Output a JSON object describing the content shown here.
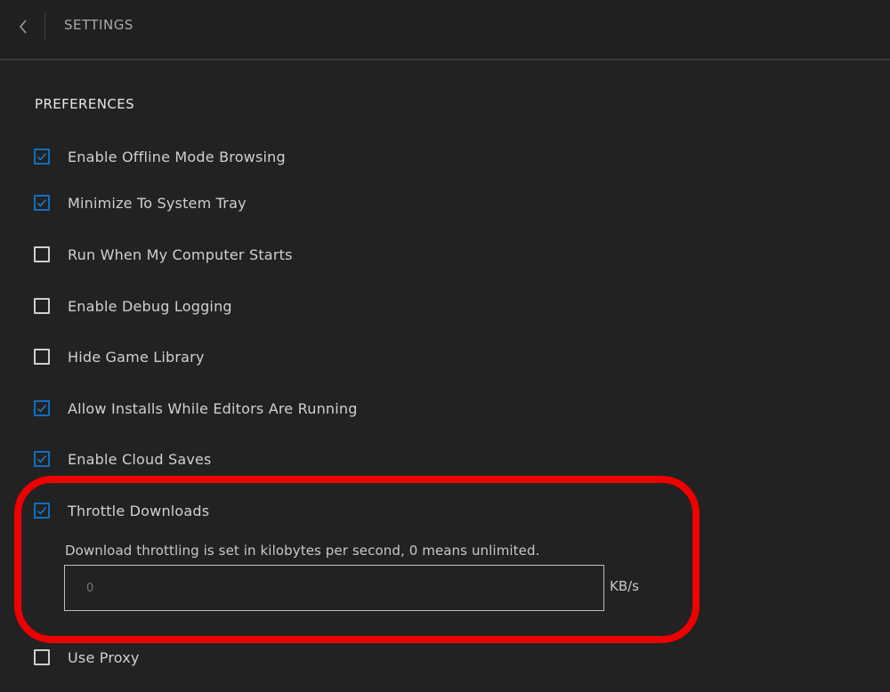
{
  "header": {
    "title": "SETTINGS"
  },
  "preferences": {
    "section_title": "PREFERENCES",
    "options": [
      {
        "label": "Enable Offline Mode Browsing",
        "checked": true
      },
      {
        "label": "Minimize To System Tray",
        "checked": true
      },
      {
        "label": "Run When My Computer Starts",
        "checked": false
      },
      {
        "label": "Enable Debug Logging",
        "checked": false
      },
      {
        "label": "Hide Game Library",
        "checked": false
      },
      {
        "label": "Allow Installs While Editors Are Running",
        "checked": true
      },
      {
        "label": "Enable Cloud Saves",
        "checked": true
      },
      {
        "label": "Throttle Downloads",
        "checked": true
      },
      {
        "label": "Use Proxy",
        "checked": false
      }
    ],
    "throttle": {
      "hint": "Download throttling is set in kilobytes per second, 0 means unlimited.",
      "placeholder": "0",
      "unit": "KB/s"
    }
  },
  "colors": {
    "background": "#222222",
    "checkbox_checked": "#0f6fc1",
    "highlight": "#ef0000"
  }
}
